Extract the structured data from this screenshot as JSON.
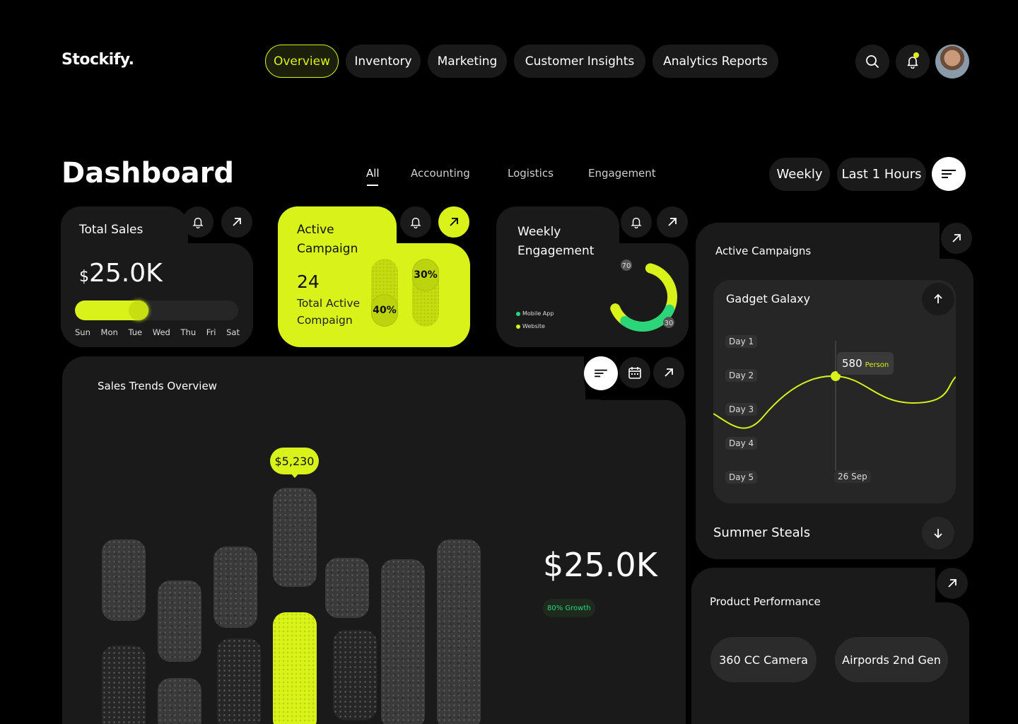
{
  "app": {
    "name": "Stockify."
  },
  "nav": {
    "items": [
      {
        "label": "Overview"
      },
      {
        "label": "Inventory"
      },
      {
        "label": "Marketing"
      },
      {
        "label": "Customer Insights"
      },
      {
        "label": "Analytics Reports"
      }
    ]
  },
  "header_icons": [
    "search-icon",
    "bell-icon",
    "avatar"
  ],
  "dashboard": {
    "title": "Dashboard",
    "subtabs": [
      {
        "label": "All"
      },
      {
        "label": "Accounting"
      },
      {
        "label": "Logistics"
      },
      {
        "label": "Engagement"
      }
    ],
    "time_filters": [
      {
        "label": "Weekly"
      },
      {
        "label": "Last 1 Hours"
      }
    ]
  },
  "total_sales": {
    "title": "Total Sales",
    "currency": "$",
    "value": "25.0K",
    "progress": 0.45,
    "days": [
      "Sun",
      "Mon",
      "Tue",
      "Wed",
      "Thu",
      "Fri",
      "Sat"
    ]
  },
  "active_campaign": {
    "title_line1": "Active",
    "title_line2": "Campaign",
    "count": "24",
    "desc_line1": "Total Active",
    "desc_line2": "Compaign",
    "pill1": "40%",
    "pill2": "30%"
  },
  "weekly_engagement": {
    "title_line1": "Weekly",
    "title_line2": "Engagement",
    "legend": [
      {
        "label": "Mobile App",
        "color": "#2bd67b"
      },
      {
        "label": "Website",
        "color": "#d9f21a"
      }
    ],
    "values": {
      "website": "70",
      "mobile": "30"
    }
  },
  "sales_trends": {
    "title": "Sales Trends Overview",
    "tooltip": "$5,230",
    "total": "$25.0K",
    "growth": "80% Growth"
  },
  "active_campaigns": {
    "title": "Active Campaigns",
    "expanded": {
      "name": "Gadget Galaxy",
      "days": [
        "Day 1",
        "Day 2",
        "Day 3",
        "Day 4",
        "Day 5"
      ],
      "tooltip_value": "580",
      "tooltip_unit": "Person",
      "date": "26 Sep"
    },
    "collapsed": {
      "name": "Summer Steals"
    }
  },
  "product_performance": {
    "title": "Product Performance",
    "products": [
      {
        "label": "360 CC Camera"
      },
      {
        "label": "Airpords 2nd Gen"
      }
    ]
  },
  "colors": {
    "accent": "#d9f21a",
    "green": "#2bd67b",
    "card": "#1a1a1a",
    "bg": "#000000"
  }
}
